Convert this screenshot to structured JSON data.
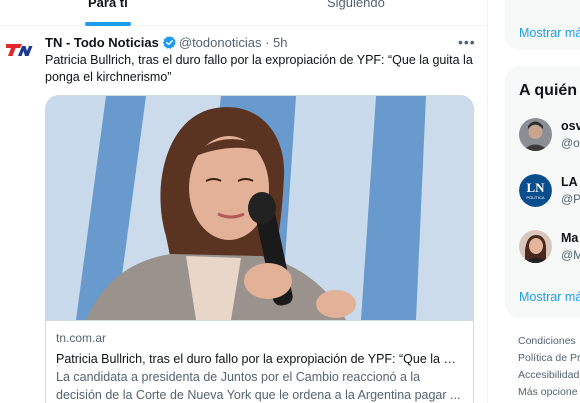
{
  "tabs": [
    {
      "label": "Para ti",
      "active": true
    },
    {
      "label": "Siguiendo",
      "active": false
    }
  ],
  "tweet": {
    "avatar_icon": "tn-logo-icon",
    "author_name": "TN - Todo Noticias",
    "verified_icon": "verified-badge-icon",
    "handle": "@todonoticias",
    "separator": "·",
    "time": "5h",
    "more_icon": "more-options-icon",
    "text": "Patricia Bullrich, tras el duro fallo por la expropiación de YPF: “Que la guita la ponga el kirchnerismo”",
    "card": {
      "domain": "tn.com.ar",
      "title": "Patricia Bullrich, tras el duro fallo por la expropiación de YPF: “Que la gu...",
      "description": "La candidata a presidenta de Juntos por el Cambio reaccionó a la decisión de la Corte de Nueva York que le ordena a la Argentina pagar ..."
    }
  },
  "sidebar": {
    "top_box": {
      "show_more": "Mostrar má"
    },
    "who_to_follow": {
      "title": "A quién",
      "items": [
        {
          "name": "osv",
          "handle": "@o"
        },
        {
          "name": "LA",
          "handle": "@P",
          "avatar_text": "LN",
          "avatar_subtext": "POLÍTICA"
        },
        {
          "name": "Ma",
          "handle": "@M"
        }
      ],
      "show_more": "Mostrar má"
    },
    "footer_links": [
      "Condiciones",
      "Política de Pr",
      "Accesibilidad",
      "Más opcione"
    ]
  },
  "colors": {
    "accent": "#1d9bf0",
    "text_primary": "#0f1419",
    "text_secondary": "#536471",
    "sidebar_bg": "#f7f9f9",
    "border": "#cfd9de",
    "brand_tn_red": "#e3262c"
  }
}
